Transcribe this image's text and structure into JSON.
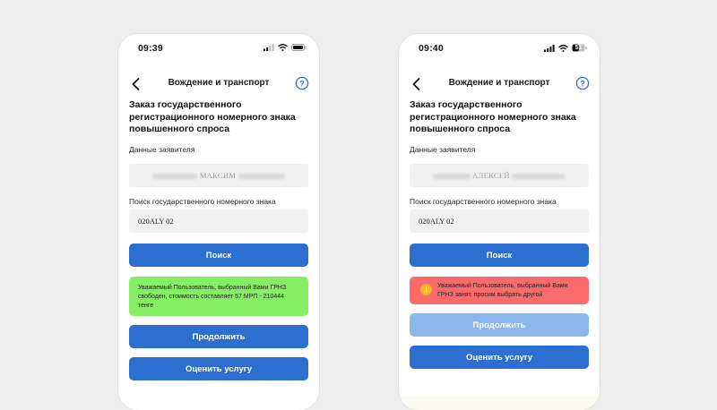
{
  "screens": [
    {
      "time": "09:39",
      "battery_label": "",
      "nav_title": "Вождение и транспорт",
      "heading": "Заказ государственного регистрационного номерного знака повышенного спроса",
      "applicant_label": "Данные заявителя",
      "applicant_name": "МАКСИМ",
      "search_label": "Поиск государственного номерного знака",
      "plate_value": "020ALY  02",
      "search_button": "Поиск",
      "message": "Уважаемый Пользователь, выбранный Вами ГРНЗ свободен, стоимость составляет 57 МРП - 210444 тенге",
      "message_status": "success",
      "continue_button": "Продолжить",
      "rate_button": "Оценить услугу"
    },
    {
      "time": "09:40",
      "battery_label": "51",
      "nav_title": "Вождение и транспорт",
      "heading": "Заказ государственного регистрационного номерного знака повышенного спроса",
      "applicant_label": "Данные заявителя",
      "applicant_name": "АЛЕКСЕЙ",
      "search_label": "Поиск государственного номерного знака",
      "plate_value": "020ALY  02",
      "search_button": "Поиск",
      "message": "Уважаемый Пользователь, выбранный Вами ГРНЗ занят, просим выбрать другой",
      "message_status": "error",
      "message_icon": "warning-icon",
      "continue_button": "Продолжить",
      "rate_button": "Оценить услугу"
    }
  ],
  "colors": {
    "primary": "#2c6fd1",
    "primary_disabled": "#8db6ec",
    "success_bg": "#86ee63",
    "error_bg": "#fb6b6b",
    "warning_icon": "#f4b526",
    "help_icon": "#2c6fd1"
  }
}
